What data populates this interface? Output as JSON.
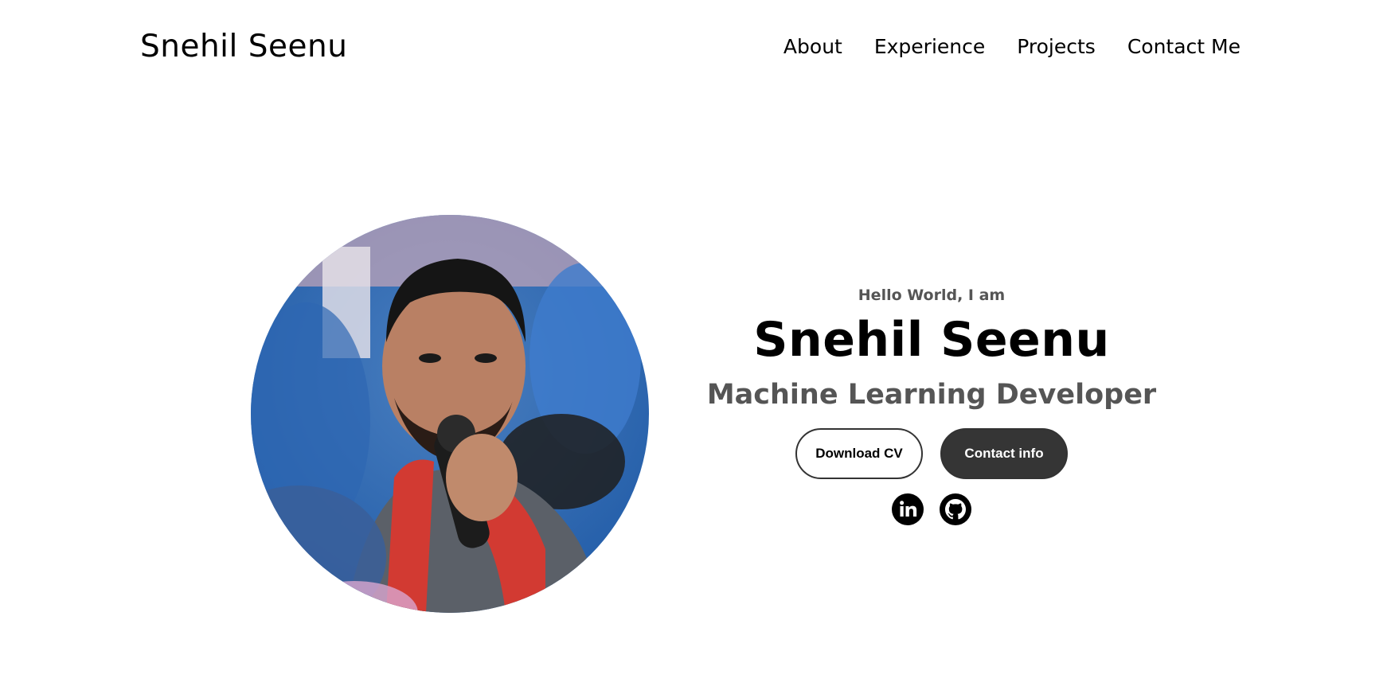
{
  "nav": {
    "logo": "Snehil Seenu",
    "links": [
      "About",
      "Experience",
      "Projects",
      "Contact Me"
    ]
  },
  "hero": {
    "greeting": "Hello World, I am",
    "name": "Snehil Seenu",
    "role": "Machine Learning Developer",
    "buttons": {
      "download_cv": "Download CV",
      "contact_info": "Contact info"
    },
    "socials": [
      "linkedin-icon",
      "github-icon"
    ],
    "photo": "profile-photo"
  },
  "colors": {
    "text": "#000000",
    "muted": "#555555",
    "button_dark": "#353535",
    "background": "#ffffff"
  }
}
